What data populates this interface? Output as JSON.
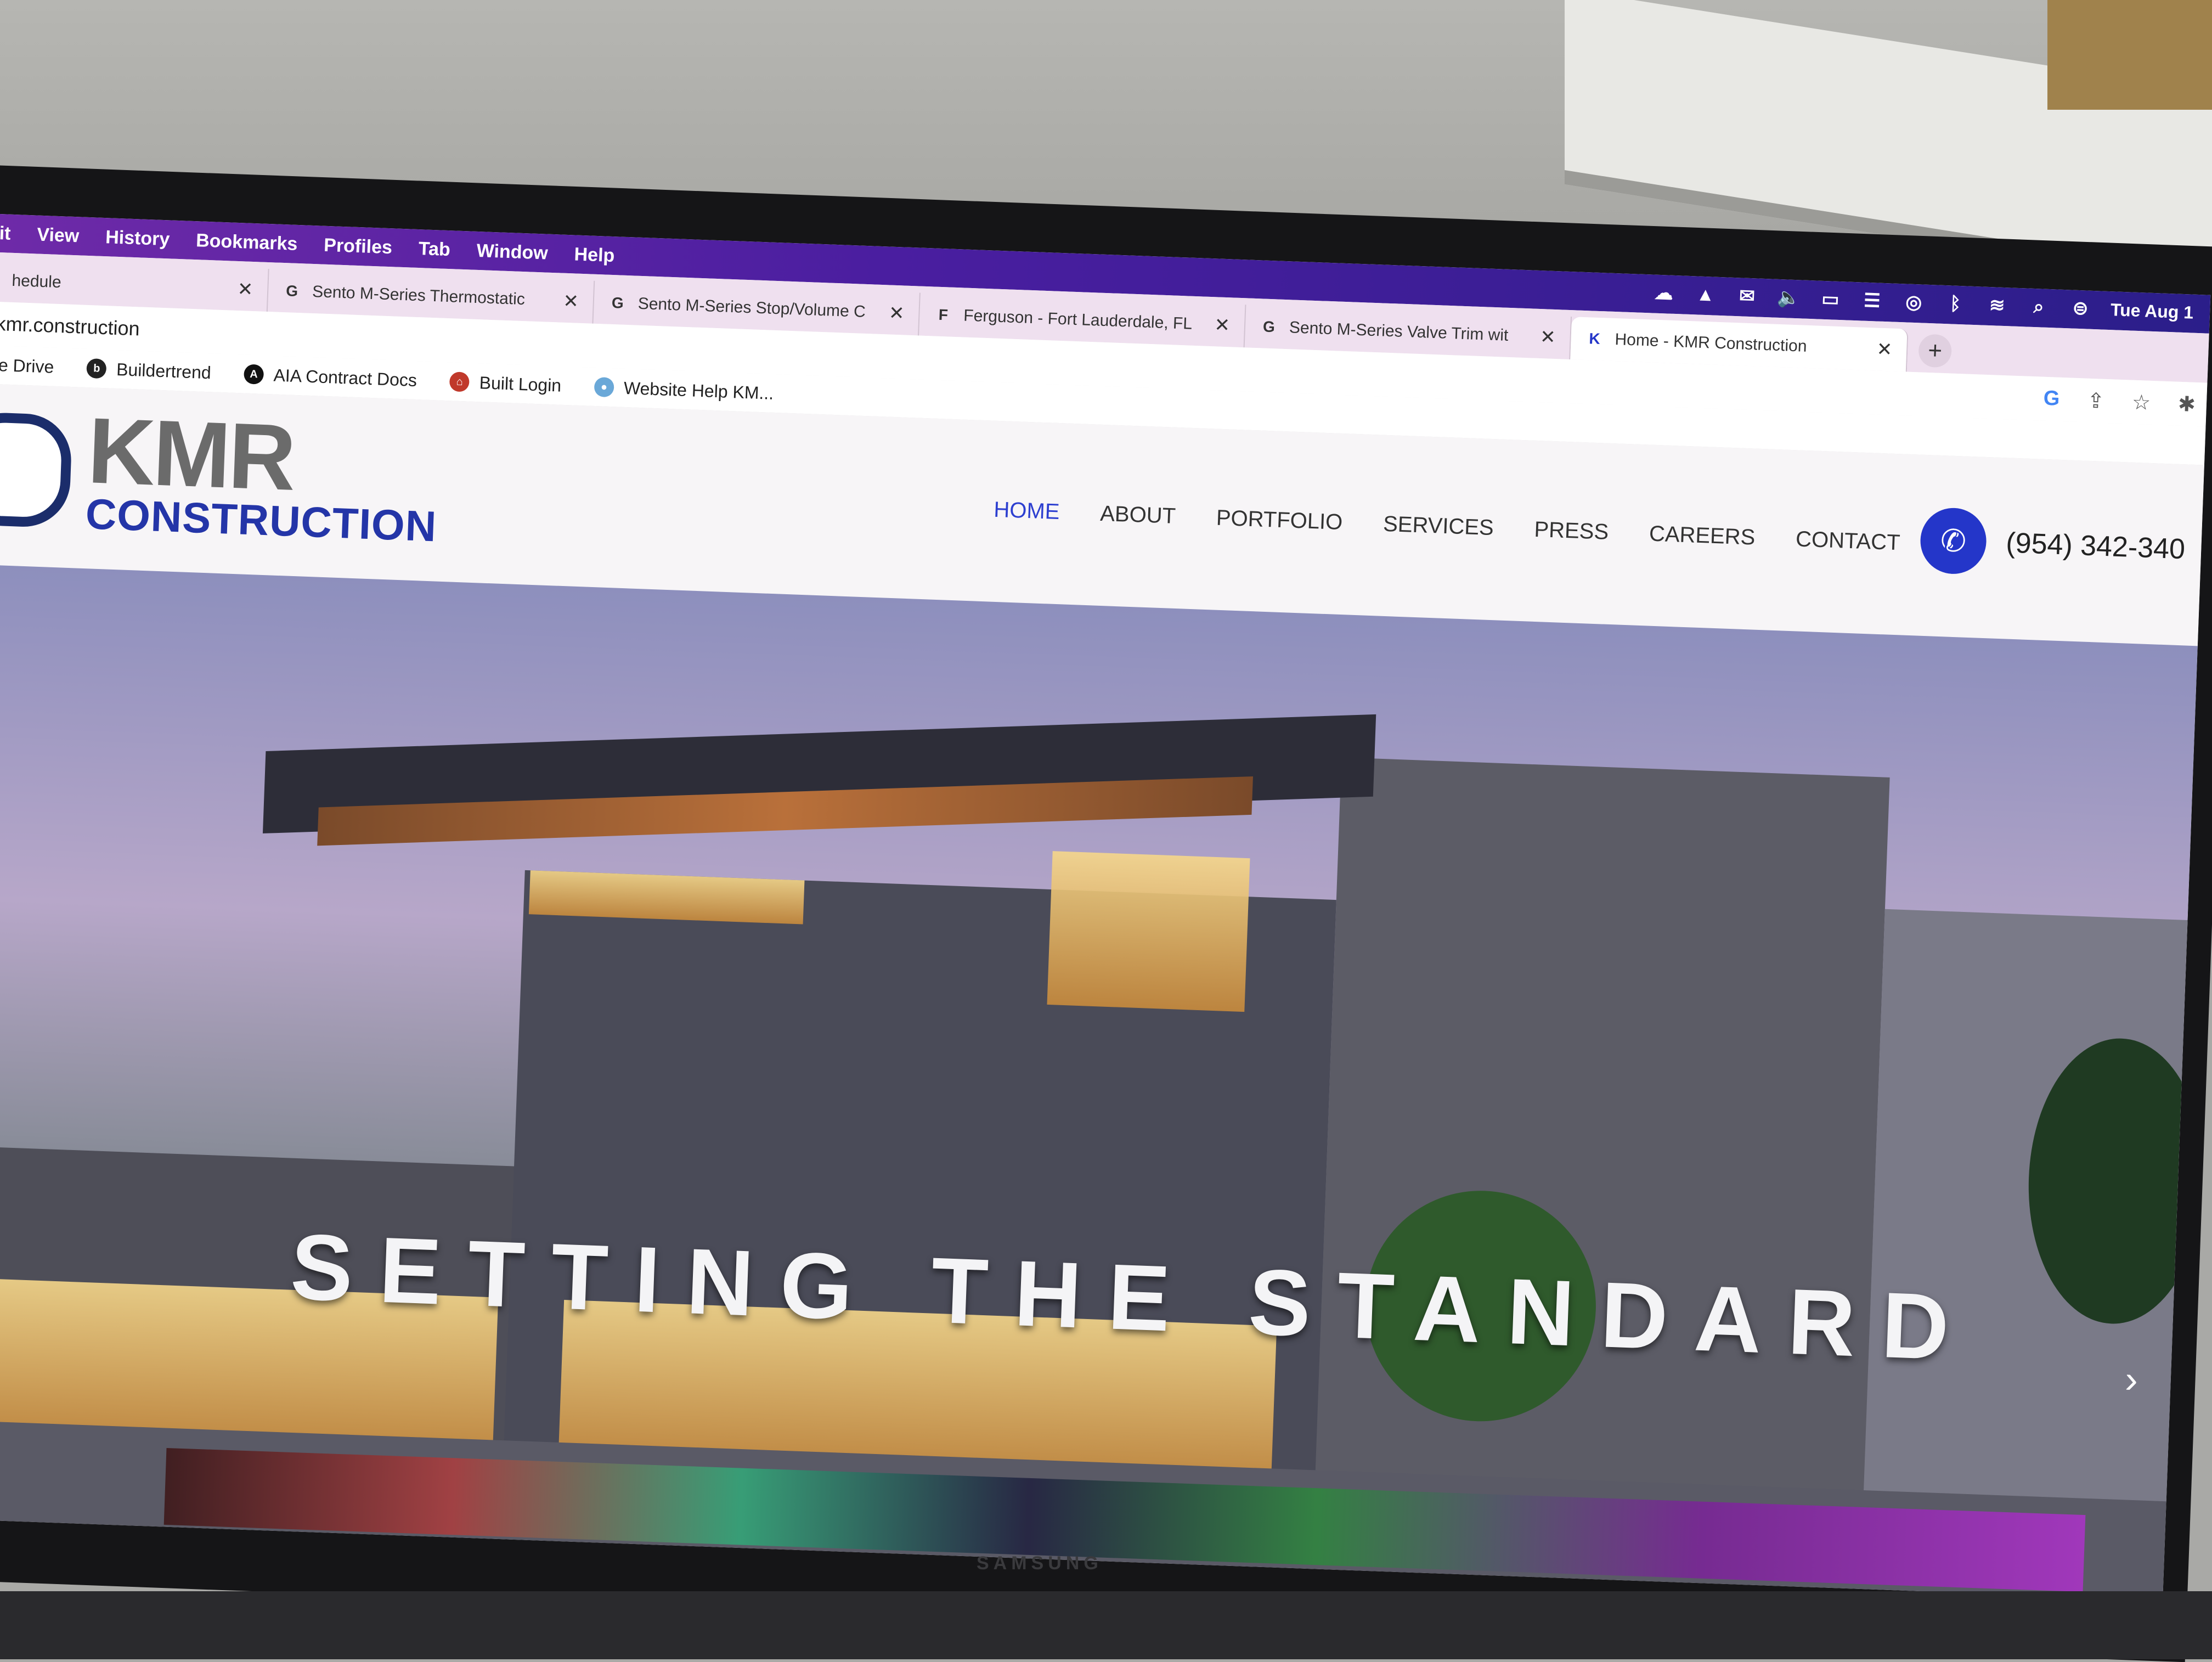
{
  "menubar": {
    "items": [
      "it",
      "View",
      "History",
      "Bookmarks",
      "Profiles",
      "Tab",
      "Window",
      "Help"
    ],
    "clock": "Tue Aug 1",
    "status_icons": [
      "creative-cloud-icon",
      "drive-icon",
      "outlook-icon",
      "volume-icon",
      "display-icon",
      "control-icon",
      "airdrop-icon",
      "bluetooth-icon",
      "wifi-icon",
      "spotlight-icon",
      "control-center-icon"
    ]
  },
  "tabs": [
    {
      "label": "hedule",
      "favicon": "",
      "active": false
    },
    {
      "label": "Sento M-Series Thermostatic",
      "favicon": "G",
      "active": false
    },
    {
      "label": "Sento M-Series Stop/Volume C",
      "favicon": "G",
      "active": false
    },
    {
      "label": "Ferguson - Fort Lauderdale, FL",
      "favicon": "F",
      "active": false
    },
    {
      "label": "Sento M-Series Valve Trim wit",
      "favicon": "G",
      "active": false
    },
    {
      "label": "Home - KMR Construction",
      "favicon": "K",
      "active": true
    }
  ],
  "address": {
    "url": "kmr.construction"
  },
  "bookmarks": [
    {
      "label": "le Drive",
      "color": ""
    },
    {
      "label": "Buildertrend",
      "color": "#222222"
    },
    {
      "label": "AIA Contract Docs",
      "color": "#111111"
    },
    {
      "label": "Built Login",
      "color": "#c0392b"
    },
    {
      "label": "Website Help KM...",
      "color": "#6aa8d8"
    }
  ],
  "site": {
    "logo_top": "KMR",
    "logo_bottom": "CONSTRUCTION",
    "nav": [
      {
        "label": "HOME",
        "active": true
      },
      {
        "label": "ABOUT",
        "active": false
      },
      {
        "label": "PORTFOLIO",
        "active": false
      },
      {
        "label": "SERVICES",
        "active": false
      },
      {
        "label": "PRESS",
        "active": false
      },
      {
        "label": "CAREERS",
        "active": false
      },
      {
        "label": "CONTACT",
        "active": false
      }
    ],
    "phone": "(954) 342-340",
    "hero_title": "SETTING THE STANDARD",
    "accent": "#2436c9"
  },
  "monitor": {
    "brand": "SAMSUNG"
  }
}
